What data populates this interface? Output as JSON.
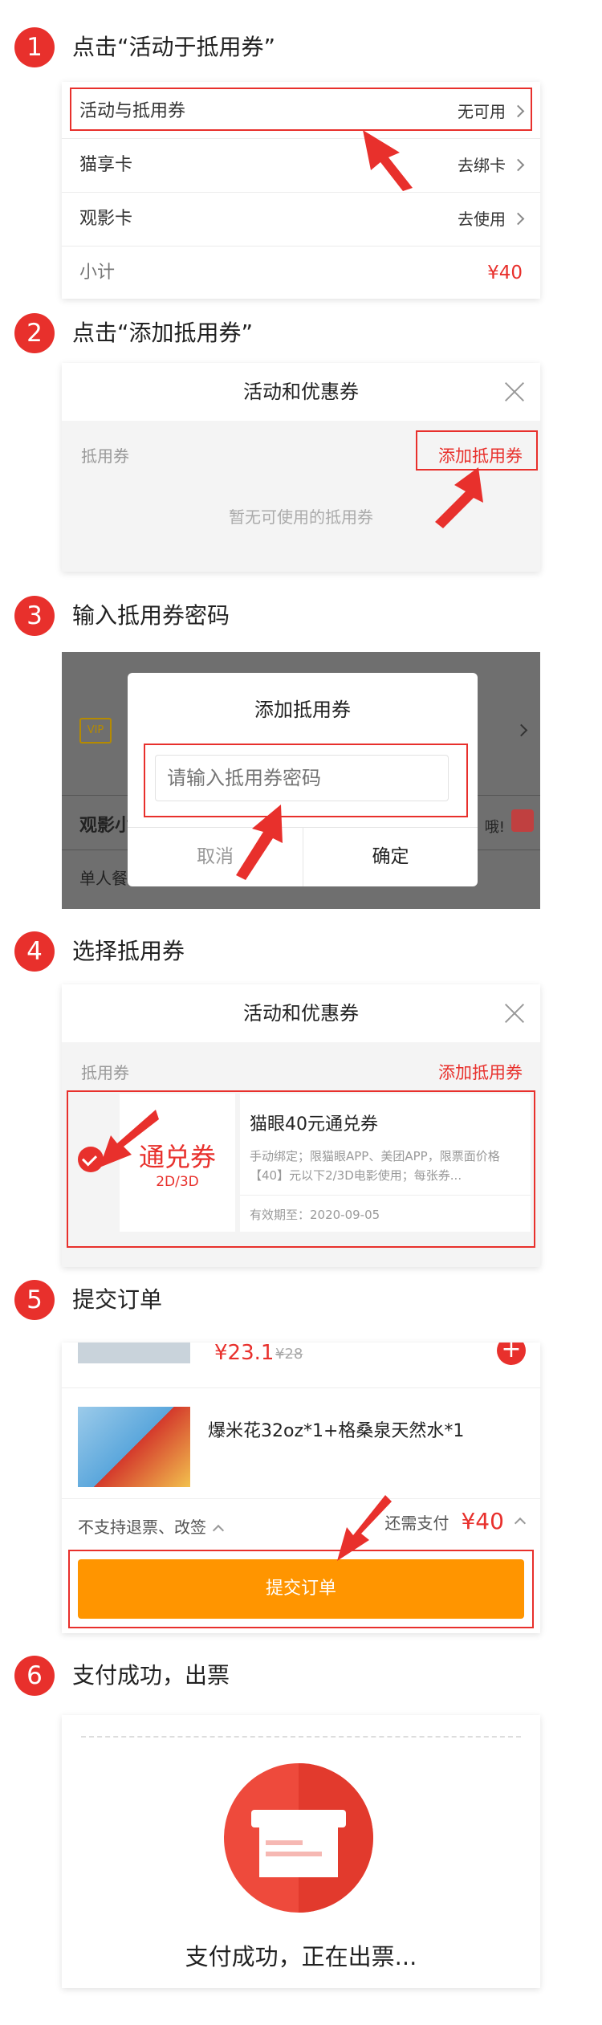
{
  "steps": [
    {
      "num": "1",
      "title": "点击“活动于抵用券”"
    },
    {
      "num": "2",
      "title": "点击“添加抵用券”"
    },
    {
      "num": "3",
      "title": "输入抵用券密码"
    },
    {
      "num": "4",
      "title": "选择抵用券"
    },
    {
      "num": "5",
      "title": "提交订单"
    },
    {
      "num": "6",
      "title": "支付成功，出票"
    }
  ],
  "step1": {
    "rows": [
      {
        "label": "活动与抵用券",
        "value": "无可用"
      },
      {
        "label": "猫享卡",
        "value": "去绑卡"
      },
      {
        "label": "观影卡",
        "value": "去使用"
      },
      {
        "label": "小计",
        "value": "¥40"
      }
    ]
  },
  "step2": {
    "title": "活动和优惠券",
    "coupon_label": "抵用券",
    "add_button": "添加抵用券",
    "empty_text": "暂无可使用的抵用券"
  },
  "step3": {
    "dialog_title": "添加抵用券",
    "input_placeholder": "请输入抵用券密码",
    "cancel": "取消",
    "confirm": "确定",
    "bg_vip": "VIP",
    "bg_row1": "观影小",
    "bg_row1_right": "哦!",
    "bg_row2": "单人餐"
  },
  "step4": {
    "title": "活动和优惠券",
    "coupon_label": "抵用券",
    "add_button": "添加抵用券",
    "coupon_type": "通兑券",
    "coupon_format": "2D/3D",
    "coupon_name": "猫眼40元通兑券",
    "coupon_desc": "手动绑定；限猫眼APP、美团APP，限票面价格【40】元以下2/3D电影使用；每张券...",
    "coupon_expiry": "有效期至：2020-09-05"
  },
  "step5": {
    "price": "¥23.1",
    "old_price": "¥28",
    "product": "爆米花32oz*1+格桑泉天然水*1",
    "policy": "不支持退票、改签",
    "need_pay_label": "还需支付",
    "need_pay": "¥40",
    "submit": "提交订单"
  },
  "step6": {
    "message": "支付成功，正在出票..."
  },
  "colors": {
    "accent": "#e8302c",
    "orange": "#ff9500"
  }
}
